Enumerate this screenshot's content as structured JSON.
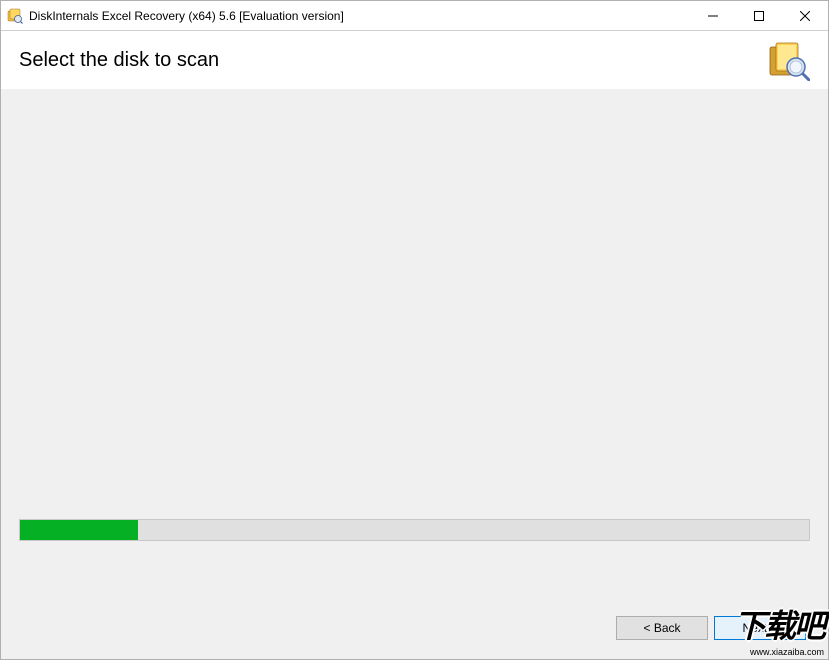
{
  "window": {
    "title": "DiskInternals Excel Recovery (x64) 5.6 [Evaluation version]"
  },
  "header": {
    "heading": "Select the disk to scan"
  },
  "progress": {
    "percent": 15
  },
  "buttons": {
    "back": "< Back",
    "next": "Next >"
  },
  "watermark": {
    "main": "下载吧",
    "sub": "www.xiazaiba.com"
  }
}
